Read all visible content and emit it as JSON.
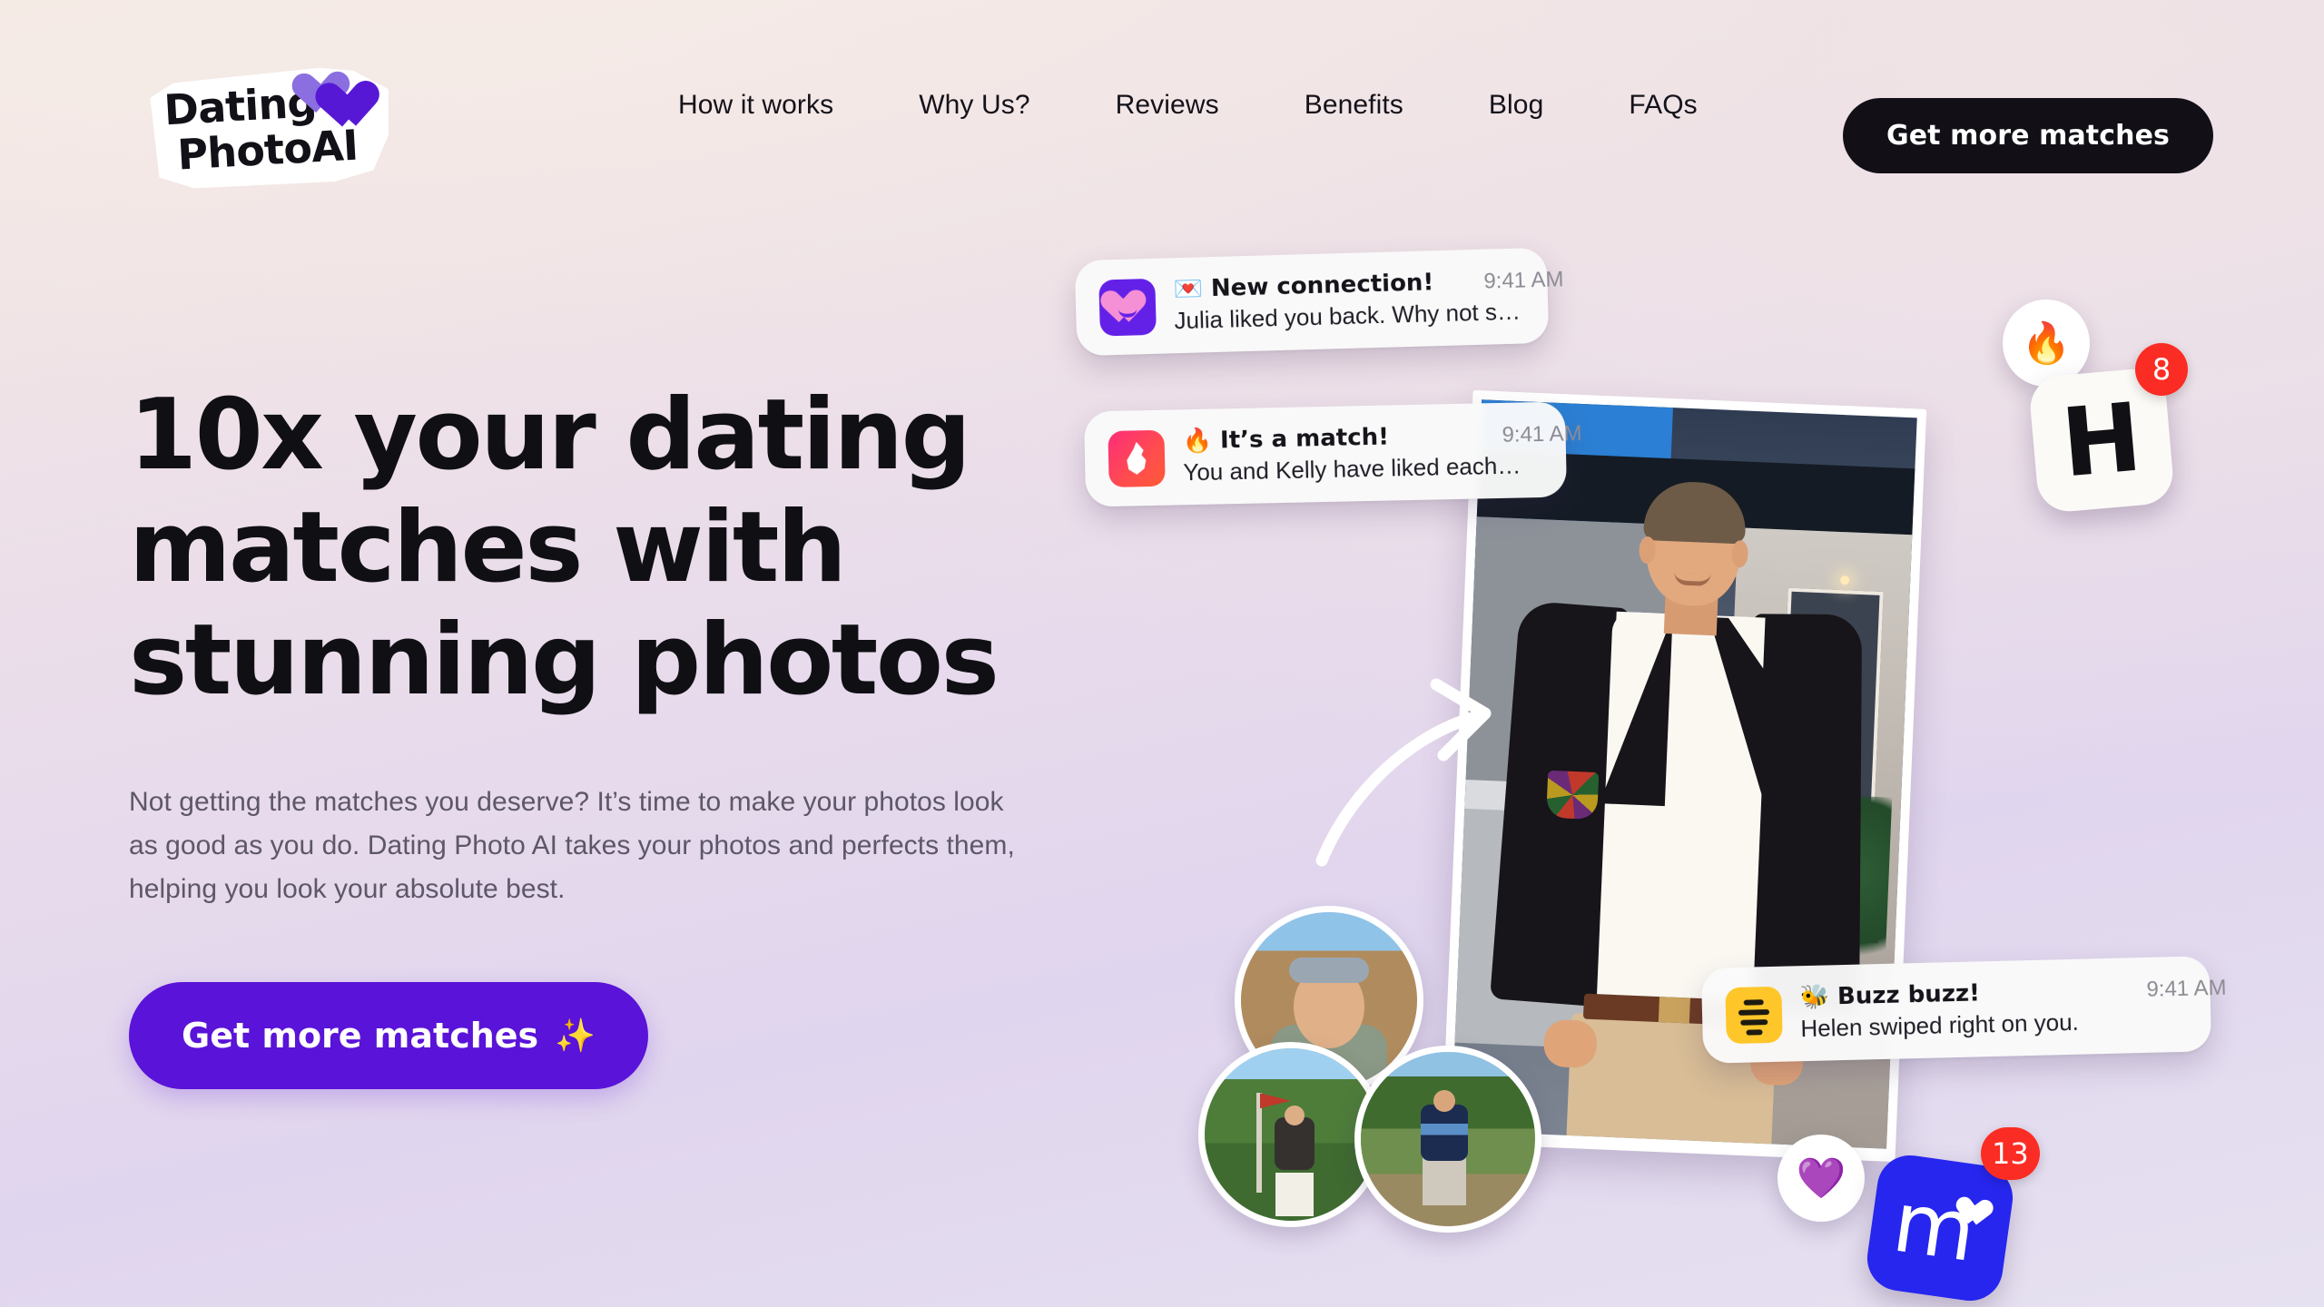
{
  "brand": {
    "logo_line1": "Dating",
    "logo_line2": "PhotoAI",
    "accent_purple": "#5a13d8",
    "accent_dark": "#121016"
  },
  "header": {
    "nav_items": [
      {
        "label": "How it works"
      },
      {
        "label": "Why Us?"
      },
      {
        "label": "Reviews"
      },
      {
        "label": "Benefits"
      },
      {
        "label": "Blog"
      },
      {
        "label": "FAQs"
      }
    ],
    "cta_label": "Get more matches"
  },
  "hero": {
    "headline": "10x your dating matches with stunning photos",
    "subhead": "Not getting the matches you deserve? It’s time to make your photos look as good as you do. Dating Photo AI takes your photos and perfects them, helping you look your absolute best.",
    "cta_label": "Get more matches",
    "cta_emoji": "✨"
  },
  "notifications": [
    {
      "app": "badoo",
      "title": "💌 New connection!",
      "time": "9:41 AM",
      "body": "Julia liked you back. Why not s…"
    },
    {
      "app": "tinder",
      "title": "🔥 It’s a match!",
      "time": "9:41 AM",
      "body": "You and Kelly have liked each…"
    },
    {
      "app": "bumble",
      "title": "🐝 Buzz buzz!",
      "time": "9:41 AM",
      "body": "Helen swiped right on you."
    }
  ],
  "floating_badges": {
    "fire_emoji": "🔥",
    "purple_heart_emoji": "💜",
    "hinge_letter": "H",
    "hinge_count": "8",
    "match_letter": "m",
    "match_count": "13"
  }
}
